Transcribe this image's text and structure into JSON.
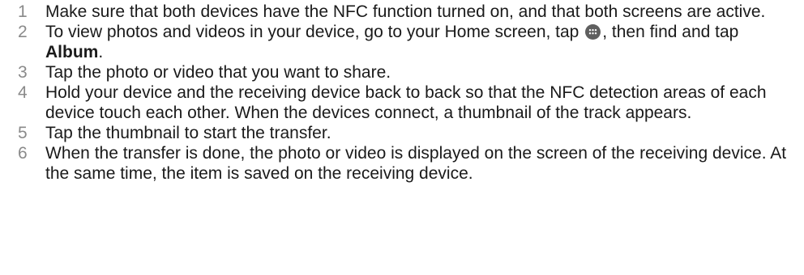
{
  "steps": [
    {
      "number": "1",
      "text": "Make sure that both devices have the NFC function turned on, and that both screens are active."
    },
    {
      "number": "2",
      "text_before": "To view photos and videos in your device, go to your Home screen, tap",
      "icon": "apps-icon",
      "text_middle": ", then find and tap",
      "bold_text": "Album",
      "text_after": "."
    },
    {
      "number": "3",
      "text": "Tap the photo or video that you want to share."
    },
    {
      "number": "4",
      "text": "Hold your device and the receiving device back to back so that the NFC detection areas of each device touch each other. When the devices connect, a thumbnail of the track appears."
    },
    {
      "number": "5",
      "text": "Tap the thumbnail to start the transfer."
    },
    {
      "number": "6",
      "text": "When the transfer is done, the photo or video is displayed on the screen of the receiving device. At the same time, the item is saved on the receiving device."
    }
  ]
}
